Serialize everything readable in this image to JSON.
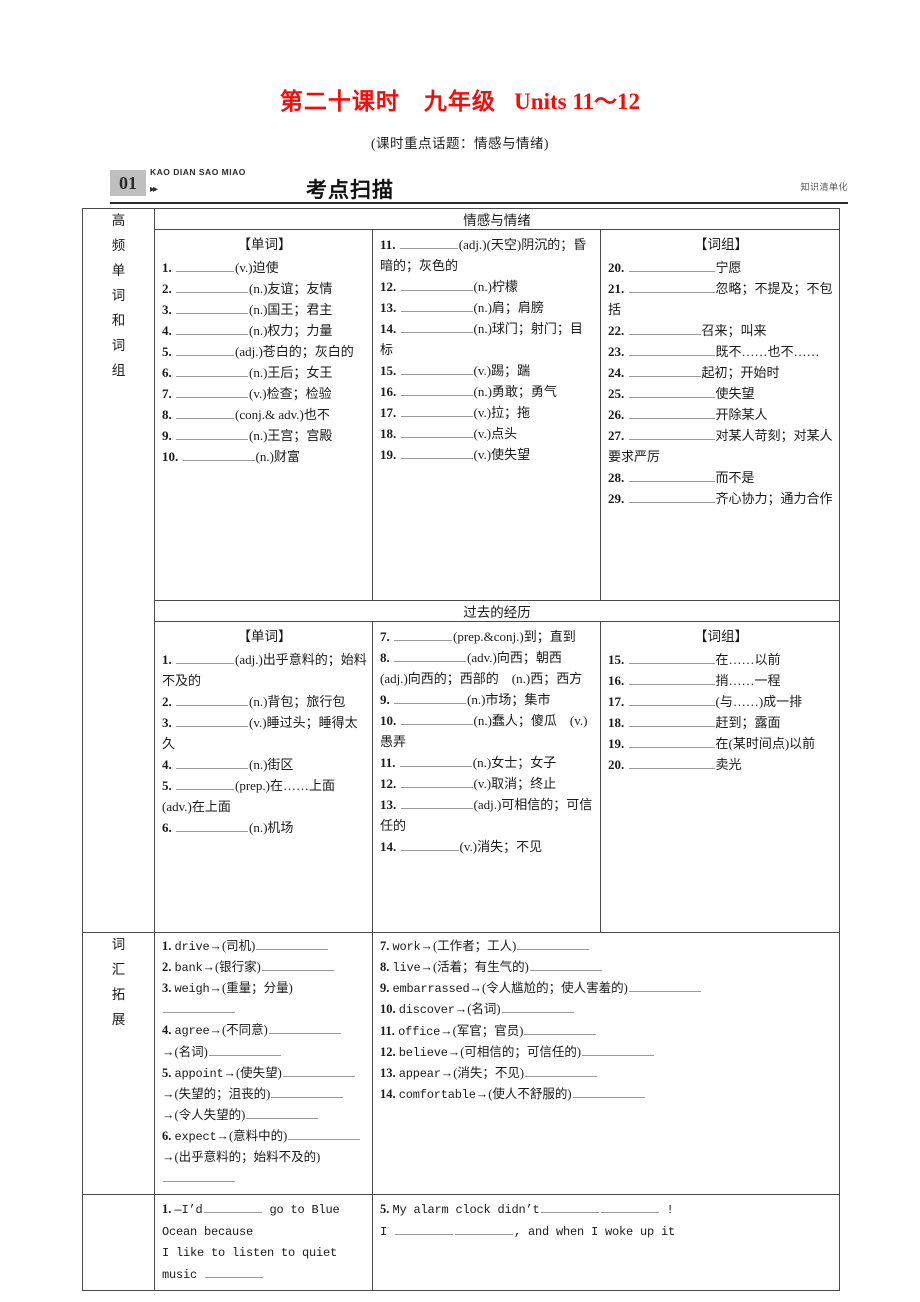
{
  "header": {
    "title_cn": "第二十课时　九年级",
    "title_units": "Units 11～12",
    "subtitle": "(课时重点话题：情感与情绪)",
    "badge_number": "01",
    "badge_arrows": "▸▸",
    "badge_pinyin": "KAO DIAN SAO MIAO",
    "badge_title": "考点扫描",
    "badge_right": "知识清单化",
    "title_color": "#f60b08"
  },
  "row_labels": {
    "high_freq": [
      "高",
      "频",
      "单",
      "词",
      "和",
      "词",
      "组"
    ],
    "vocab_ext": [
      "词",
      "汇",
      "拓",
      "展"
    ],
    "sentences": []
  },
  "sections": [
    {
      "heading": "情感与情绪",
      "col1": {
        "group": "【单词】",
        "items": [
          {
            "n": "1.",
            "blank": "m",
            "text": "(v.)迫使"
          },
          {
            "n": "2.",
            "blank": "l",
            "text": "(n.)友谊；友情"
          },
          {
            "n": "3.",
            "blank": "l",
            "text": "(n.)国王；君主"
          },
          {
            "n": "4.",
            "blank": "l",
            "text": "(n.)权力；力量"
          },
          {
            "n": "5.",
            "blank": "m",
            "text": "(adj.)苍白的；灰白的"
          },
          {
            "n": "6.",
            "blank": "l",
            "text": "(n.)王后；女王"
          },
          {
            "n": "7.",
            "blank": "l",
            "text": "(v.)检查；检验"
          },
          {
            "n": "8.",
            "blank": "m",
            "text": "(conj.& adv.)也不"
          },
          {
            "n": "9.",
            "blank": "l",
            "text": "(n.)王宫；宫殿"
          },
          {
            "n": "10.",
            "blank": "l",
            "text": "(n.)财富"
          }
        ]
      },
      "col2": {
        "group": "",
        "items": [
          {
            "n": "11.",
            "blank": "m",
            "text": "(adj.)(天空)阴沉的；昏暗的；灰色的"
          },
          {
            "n": "12.",
            "blank": "l",
            "text": "(n.)柠檬"
          },
          {
            "n": "13.",
            "blank": "l",
            "text": "(n.)肩；肩膀"
          },
          {
            "n": "14.",
            "blank": "l",
            "text": "(n.)球门；射门；目标"
          },
          {
            "n": "15.",
            "blank": "l",
            "text": "(v.)踢；踹"
          },
          {
            "n": "16.",
            "blank": "l",
            "text": "(n.)勇敢；勇气"
          },
          {
            "n": "17.",
            "blank": "l",
            "text": "(v.)拉；拖"
          },
          {
            "n": "18.",
            "blank": "l",
            "text": "(v.)点头"
          },
          {
            "n": "19.",
            "blank": "l",
            "text": "(v.)使失望"
          }
        ]
      },
      "col3": {
        "group": "【词组】",
        "items": [
          {
            "n": "20.",
            "blank": "xl",
            "text": "宁愿"
          },
          {
            "n": "21.",
            "blank": "xl",
            "text": "忽略；不提及；不包括"
          },
          {
            "n": "22.",
            "blank": "l",
            "text": "召来；叫来"
          },
          {
            "n": "23.",
            "blank": "xl",
            "text": "既不……也不……"
          },
          {
            "n": "24.",
            "blank": "l",
            "text": "起初；开始时"
          },
          {
            "n": "25.",
            "blank": "xl",
            "text": "使失望"
          },
          {
            "n": "26.",
            "blank": "xl",
            "text": "开除某人"
          },
          {
            "n": "27.",
            "blank": "xl",
            "text": "对某人苛刻；对某人要求严厉"
          },
          {
            "n": "28.",
            "blank": "xl",
            "text": "而不是"
          },
          {
            "n": "29.",
            "blank": "xl",
            "text": "齐心协力；通力合作"
          }
        ]
      }
    },
    {
      "heading": "过去的经历",
      "col1": {
        "group": "【单词】",
        "items": [
          {
            "n": "1.",
            "blank": "m",
            "text": "(adj.)出乎意料的；始料不及的"
          },
          {
            "n": "2.",
            "blank": "l",
            "text": "(n.)背包；旅行包"
          },
          {
            "n": "3.",
            "blank": "l",
            "text": "(v.)睡过头；睡得太久"
          },
          {
            "n": "4.",
            "blank": "l",
            "text": "(n.)街区"
          },
          {
            "n": "5.",
            "blank": "m",
            "text": "(prep.)在……上面　(adv.)在上面"
          },
          {
            "n": "6.",
            "blank": "l",
            "text": "(n.)机场"
          }
        ]
      },
      "col2": {
        "group": "",
        "items": [
          {
            "n": "7.",
            "blank": "m",
            "text": "(prep.&conj.)到；直到"
          },
          {
            "n": "8.",
            "blank": "l",
            "text": "(adv.)向西；朝西　(adj.)向西的；西部的　(n.)西；西方"
          },
          {
            "n": "9.",
            "blank": "l",
            "text": "(n.)市场；集市"
          },
          {
            "n": "10.",
            "blank": "l",
            "text": "(n.)蠢人；傻瓜　(v.)愚弄"
          },
          {
            "n": "11.",
            "blank": "l",
            "text": "(n.)女士；女子"
          },
          {
            "n": "12.",
            "blank": "l",
            "text": "(v.)取消；终止"
          },
          {
            "n": "13.",
            "blank": "l",
            "text": "(adj.)可相信的；可信任的"
          },
          {
            "n": "14.",
            "blank": "m",
            "text": "(v.)消失；不见"
          }
        ]
      },
      "col3": {
        "group": "【词组】",
        "items": [
          {
            "n": "15.",
            "blank": "xl",
            "text": "在……以前"
          },
          {
            "n": "16.",
            "blank": "xl",
            "text": "捎……一程"
          },
          {
            "n": "17.",
            "blank": "xl",
            "text": "(与……)成一排"
          },
          {
            "n": "18.",
            "blank": "xl",
            "text": "赶到；露面"
          },
          {
            "n": "19.",
            "blank": "xl",
            "text": "在(某时间点)以前"
          },
          {
            "n": "20.",
            "blank": "xl",
            "text": "卖光"
          }
        ]
      }
    }
  ],
  "vocab_extension": {
    "left": [
      {
        "n": "1.",
        "parts": [
          "drive",
          "→",
          "(司机)",
          "_"
        ]
      },
      {
        "n": "2.",
        "parts": [
          "bank",
          "→",
          "(银行家)",
          "_"
        ]
      },
      {
        "n": "3.",
        "parts": [
          "weigh",
          "→",
          "(重量；分量)",
          "_"
        ]
      },
      {
        "n": "4.",
        "parts": [
          "agree",
          "→",
          "(不同意)",
          "_",
          "→",
          "(名词)",
          "_"
        ]
      },
      {
        "n": "5.",
        "parts": [
          "appoint",
          "→",
          "(使失望)",
          "_",
          "→",
          "(失望的；沮丧的)",
          "_",
          "→",
          "(令人失望的)",
          "_"
        ]
      },
      {
        "n": "6.",
        "parts": [
          "expect",
          "→",
          "(意料中的)",
          "_",
          "→",
          "(出乎意料的；始料不及的)",
          "_"
        ]
      }
    ],
    "right": [
      {
        "n": "7.",
        "parts": [
          "work",
          "→",
          "(工作者；工人)",
          "_"
        ]
      },
      {
        "n": "8.",
        "parts": [
          "live",
          "→",
          "(活着；有生气的)",
          "_"
        ]
      },
      {
        "n": "9.",
        "parts": [
          "embarrassed",
          "→",
          "(令人尴尬的；使人害羞的)",
          "_"
        ]
      },
      {
        "n": "10.",
        "parts": [
          "discover",
          "→",
          "(名词)",
          "_"
        ]
      },
      {
        "n": "11.",
        "parts": [
          "office",
          "→",
          "(军官；官员)",
          "_"
        ]
      },
      {
        "n": "12.",
        "parts": [
          "believe",
          "→",
          "(可相信的；可信任的)",
          "_"
        ]
      },
      {
        "n": "13.",
        "parts": [
          "appear",
          "→",
          "(消失；不见)",
          "_"
        ]
      },
      {
        "n": "14.",
        "parts": [
          "comfortable",
          "→",
          "(使人不舒服的)",
          "_"
        ]
      }
    ]
  },
  "sentences": {
    "left": {
      "n": "1.",
      "line1_a": "—I’d",
      "line1_b": "go to Blue Ocean because",
      "line2_a": "I like to listen to quiet music"
    },
    "right": {
      "n": "5.",
      "line1_a": "My alarm clock didn’t",
      "line1_b": "!",
      "line2_a": "I",
      "line2_b": ", and when I woke up it"
    }
  }
}
